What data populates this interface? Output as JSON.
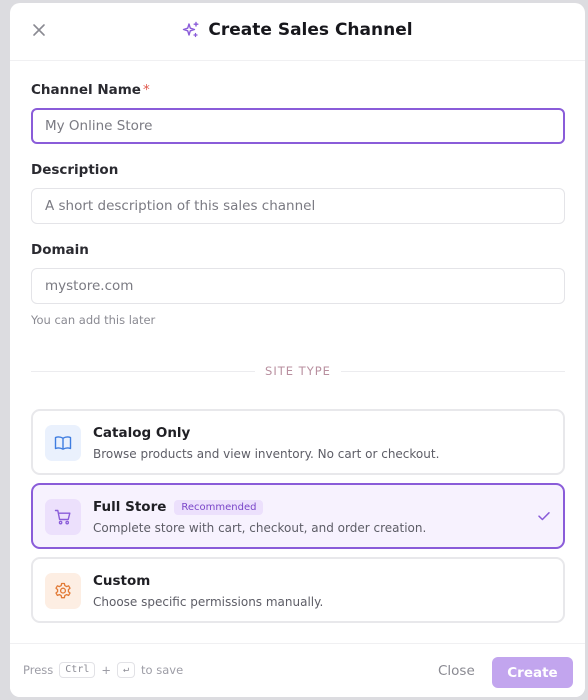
{
  "dialog": {
    "title": "Create Sales Channel",
    "title_icon": "sparkles-icon",
    "close_icon": "close-icon"
  },
  "form": {
    "channel_name": {
      "label": "Channel Name",
      "required_mark": "*",
      "placeholder": "My Online Store",
      "value": ""
    },
    "description": {
      "label": "Description",
      "placeholder": "A short description of this sales channel",
      "value": ""
    },
    "domain": {
      "label": "Domain",
      "placeholder": "mystore.com",
      "value": "",
      "hint": "You can add this later"
    }
  },
  "site_type": {
    "heading": "SITE TYPE",
    "options": [
      {
        "title": "Catalog Only",
        "description": "Browse products and view inventory. No cart or checkout.",
        "icon": "book-open-icon",
        "selected": false
      },
      {
        "title": "Full Store",
        "badge": "Recommended",
        "description": "Complete store with cart, checkout, and order creation.",
        "icon": "shopping-cart-icon",
        "selected": true
      },
      {
        "title": "Custom",
        "description": "Choose specific permissions manually.",
        "icon": "settings-gear-icon",
        "selected": false
      }
    ]
  },
  "footer": {
    "shortcut_prefix": "Press",
    "shortcut_key1": "Ctrl",
    "shortcut_plus": "+",
    "shortcut_key2": "↵",
    "shortcut_suffix": "to save",
    "close_label": "Close",
    "create_label": "Create"
  },
  "colors": {
    "accent": "#8a5cd9",
    "create_button_disabled": "#c2a5ee",
    "catalog_icon_bg": "#eaf1fd",
    "store_icon_bg": "#ece0fc",
    "custom_icon_bg": "#fdeee3"
  }
}
